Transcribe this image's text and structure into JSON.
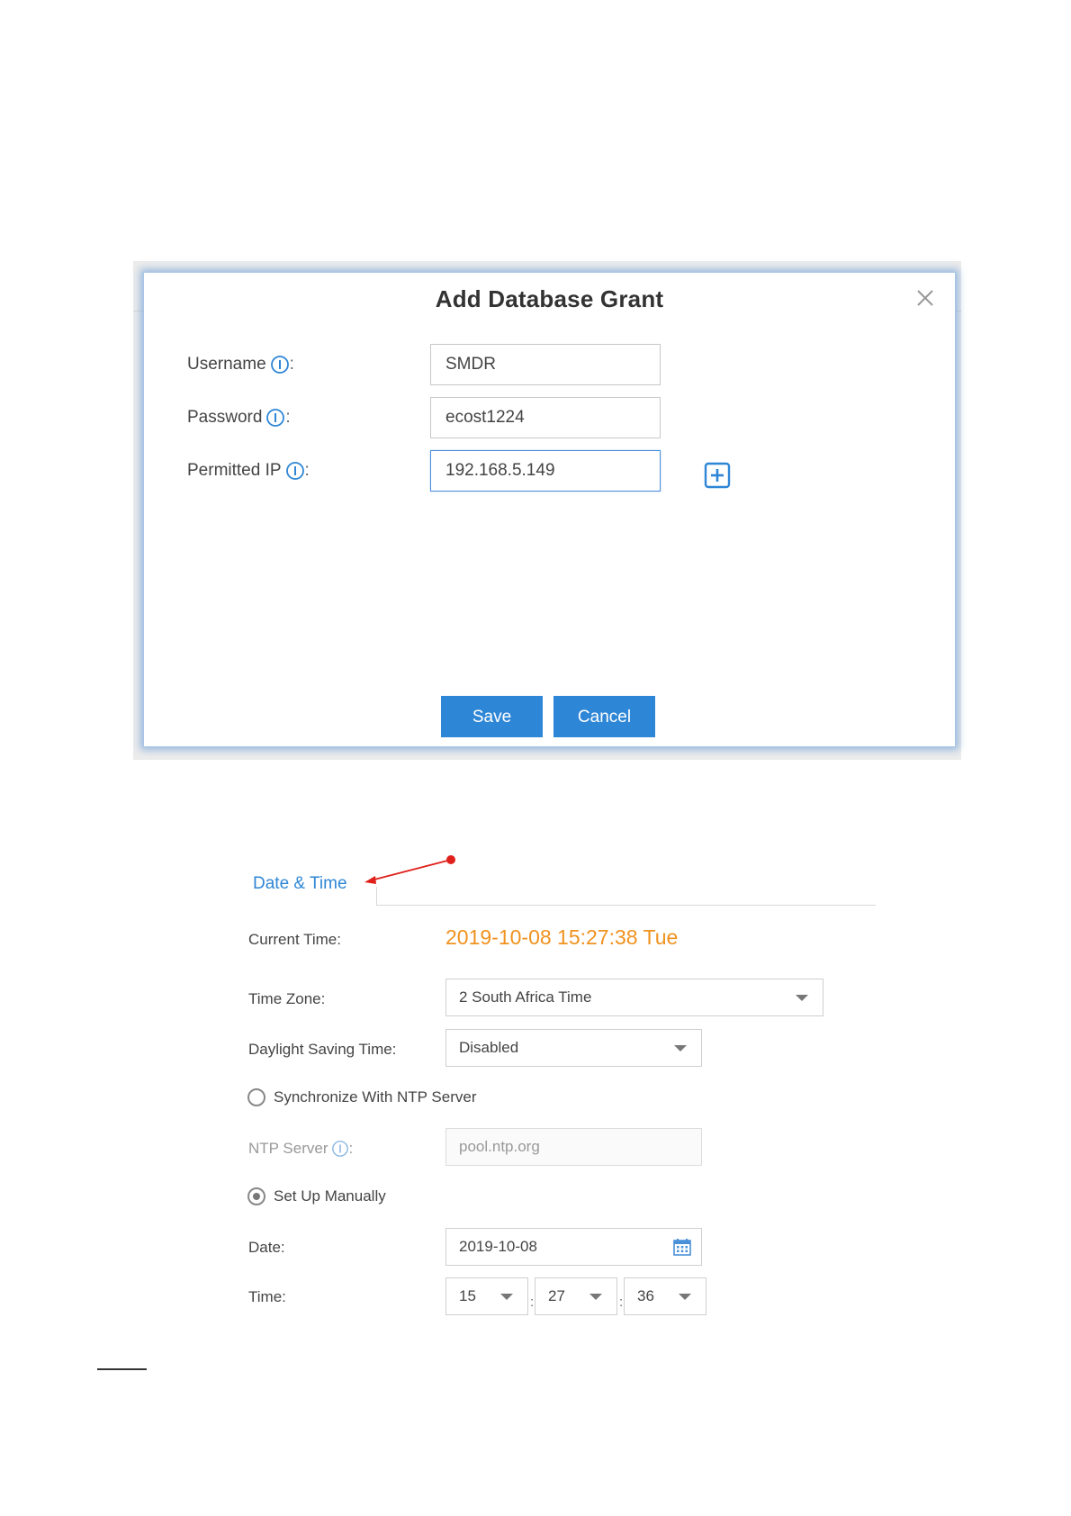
{
  "dialog": {
    "title": "Add Database Grant",
    "fields": [
      {
        "label": "Username",
        "value": "SMDR"
      },
      {
        "label": "Password",
        "value": "ecost1224"
      },
      {
        "label": "Permitted IP",
        "value": "192.168.5.149"
      }
    ],
    "colon": ":",
    "save_label": "Save",
    "cancel_label": "Cancel"
  },
  "datetime": {
    "tab_label": "Date & Time",
    "current_time_label": "Current Time:",
    "current_time_value": "2019-10-08 15:27:38 Tue",
    "time_zone_label": "Time Zone:",
    "time_zone_value": "2 South Africa Time",
    "dst_label": "Daylight Saving Time:",
    "dst_value": "Disabled",
    "ntp_option_label": "Synchronize With NTP Server",
    "ntp_server_label": "NTP Server",
    "ntp_server_value": "pool.ntp.org",
    "manual_option_label": "Set Up Manually",
    "date_label": "Date:",
    "date_value": "2019-10-08",
    "time_label": "Time:",
    "hour": "15",
    "minute": "27",
    "second": "36",
    "time_separator": ":"
  },
  "colors": {
    "accent": "#2e86d6",
    "current_time": "#f0921f",
    "annotation_arrow": "#e0201b"
  },
  "icons": [
    "close-icon",
    "info-icon",
    "plus-icon",
    "calendar-icon",
    "chevron-down-icon"
  ]
}
